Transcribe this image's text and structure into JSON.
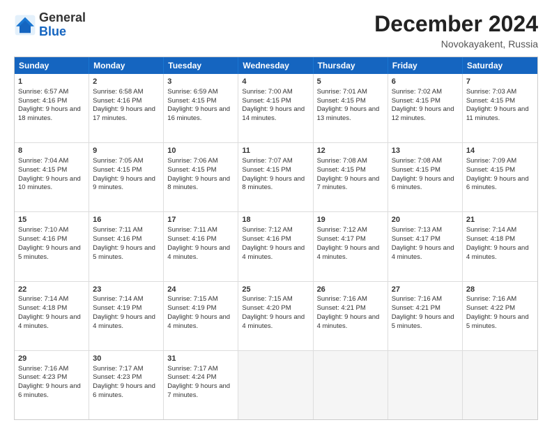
{
  "header": {
    "logo_general": "General",
    "logo_blue": "Blue",
    "month_title": "December 2024",
    "location": "Novokayakent, Russia"
  },
  "days_of_week": [
    "Sunday",
    "Monday",
    "Tuesday",
    "Wednesday",
    "Thursday",
    "Friday",
    "Saturday"
  ],
  "weeks": [
    [
      {
        "day": "1",
        "sunrise": "Sunrise: 6:57 AM",
        "sunset": "Sunset: 4:16 PM",
        "daylight": "Daylight: 9 hours and 18 minutes."
      },
      {
        "day": "2",
        "sunrise": "Sunrise: 6:58 AM",
        "sunset": "Sunset: 4:16 PM",
        "daylight": "Daylight: 9 hours and 17 minutes."
      },
      {
        "day": "3",
        "sunrise": "Sunrise: 6:59 AM",
        "sunset": "Sunset: 4:15 PM",
        "daylight": "Daylight: 9 hours and 16 minutes."
      },
      {
        "day": "4",
        "sunrise": "Sunrise: 7:00 AM",
        "sunset": "Sunset: 4:15 PM",
        "daylight": "Daylight: 9 hours and 14 minutes."
      },
      {
        "day": "5",
        "sunrise": "Sunrise: 7:01 AM",
        "sunset": "Sunset: 4:15 PM",
        "daylight": "Daylight: 9 hours and 13 minutes."
      },
      {
        "day": "6",
        "sunrise": "Sunrise: 7:02 AM",
        "sunset": "Sunset: 4:15 PM",
        "daylight": "Daylight: 9 hours and 12 minutes."
      },
      {
        "day": "7",
        "sunrise": "Sunrise: 7:03 AM",
        "sunset": "Sunset: 4:15 PM",
        "daylight": "Daylight: 9 hours and 11 minutes."
      }
    ],
    [
      {
        "day": "8",
        "sunrise": "Sunrise: 7:04 AM",
        "sunset": "Sunset: 4:15 PM",
        "daylight": "Daylight: 9 hours and 10 minutes."
      },
      {
        "day": "9",
        "sunrise": "Sunrise: 7:05 AM",
        "sunset": "Sunset: 4:15 PM",
        "daylight": "Daylight: 9 hours and 9 minutes."
      },
      {
        "day": "10",
        "sunrise": "Sunrise: 7:06 AM",
        "sunset": "Sunset: 4:15 PM",
        "daylight": "Daylight: 9 hours and 8 minutes."
      },
      {
        "day": "11",
        "sunrise": "Sunrise: 7:07 AM",
        "sunset": "Sunset: 4:15 PM",
        "daylight": "Daylight: 9 hours and 8 minutes."
      },
      {
        "day": "12",
        "sunrise": "Sunrise: 7:08 AM",
        "sunset": "Sunset: 4:15 PM",
        "daylight": "Daylight: 9 hours and 7 minutes."
      },
      {
        "day": "13",
        "sunrise": "Sunrise: 7:08 AM",
        "sunset": "Sunset: 4:15 PM",
        "daylight": "Daylight: 9 hours and 6 minutes."
      },
      {
        "day": "14",
        "sunrise": "Sunrise: 7:09 AM",
        "sunset": "Sunset: 4:15 PM",
        "daylight": "Daylight: 9 hours and 6 minutes."
      }
    ],
    [
      {
        "day": "15",
        "sunrise": "Sunrise: 7:10 AM",
        "sunset": "Sunset: 4:16 PM",
        "daylight": "Daylight: 9 hours and 5 minutes."
      },
      {
        "day": "16",
        "sunrise": "Sunrise: 7:11 AM",
        "sunset": "Sunset: 4:16 PM",
        "daylight": "Daylight: 9 hours and 5 minutes."
      },
      {
        "day": "17",
        "sunrise": "Sunrise: 7:11 AM",
        "sunset": "Sunset: 4:16 PM",
        "daylight": "Daylight: 9 hours and 4 minutes."
      },
      {
        "day": "18",
        "sunrise": "Sunrise: 7:12 AM",
        "sunset": "Sunset: 4:16 PM",
        "daylight": "Daylight: 9 hours and 4 minutes."
      },
      {
        "day": "19",
        "sunrise": "Sunrise: 7:12 AM",
        "sunset": "Sunset: 4:17 PM",
        "daylight": "Daylight: 9 hours and 4 minutes."
      },
      {
        "day": "20",
        "sunrise": "Sunrise: 7:13 AM",
        "sunset": "Sunset: 4:17 PM",
        "daylight": "Daylight: 9 hours and 4 minutes."
      },
      {
        "day": "21",
        "sunrise": "Sunrise: 7:14 AM",
        "sunset": "Sunset: 4:18 PM",
        "daylight": "Daylight: 9 hours and 4 minutes."
      }
    ],
    [
      {
        "day": "22",
        "sunrise": "Sunrise: 7:14 AM",
        "sunset": "Sunset: 4:18 PM",
        "daylight": "Daylight: 9 hours and 4 minutes."
      },
      {
        "day": "23",
        "sunrise": "Sunrise: 7:14 AM",
        "sunset": "Sunset: 4:19 PM",
        "daylight": "Daylight: 9 hours and 4 minutes."
      },
      {
        "day": "24",
        "sunrise": "Sunrise: 7:15 AM",
        "sunset": "Sunset: 4:19 PM",
        "daylight": "Daylight: 9 hours and 4 minutes."
      },
      {
        "day": "25",
        "sunrise": "Sunrise: 7:15 AM",
        "sunset": "Sunset: 4:20 PM",
        "daylight": "Daylight: 9 hours and 4 minutes."
      },
      {
        "day": "26",
        "sunrise": "Sunrise: 7:16 AM",
        "sunset": "Sunset: 4:21 PM",
        "daylight": "Daylight: 9 hours and 4 minutes."
      },
      {
        "day": "27",
        "sunrise": "Sunrise: 7:16 AM",
        "sunset": "Sunset: 4:21 PM",
        "daylight": "Daylight: 9 hours and 5 minutes."
      },
      {
        "day": "28",
        "sunrise": "Sunrise: 7:16 AM",
        "sunset": "Sunset: 4:22 PM",
        "daylight": "Daylight: 9 hours and 5 minutes."
      }
    ],
    [
      {
        "day": "29",
        "sunrise": "Sunrise: 7:16 AM",
        "sunset": "Sunset: 4:23 PM",
        "daylight": "Daylight: 9 hours and 6 minutes."
      },
      {
        "day": "30",
        "sunrise": "Sunrise: 7:17 AM",
        "sunset": "Sunset: 4:23 PM",
        "daylight": "Daylight: 9 hours and 6 minutes."
      },
      {
        "day": "31",
        "sunrise": "Sunrise: 7:17 AM",
        "sunset": "Sunset: 4:24 PM",
        "daylight": "Daylight: 9 hours and 7 minutes."
      },
      null,
      null,
      null,
      null
    ]
  ]
}
